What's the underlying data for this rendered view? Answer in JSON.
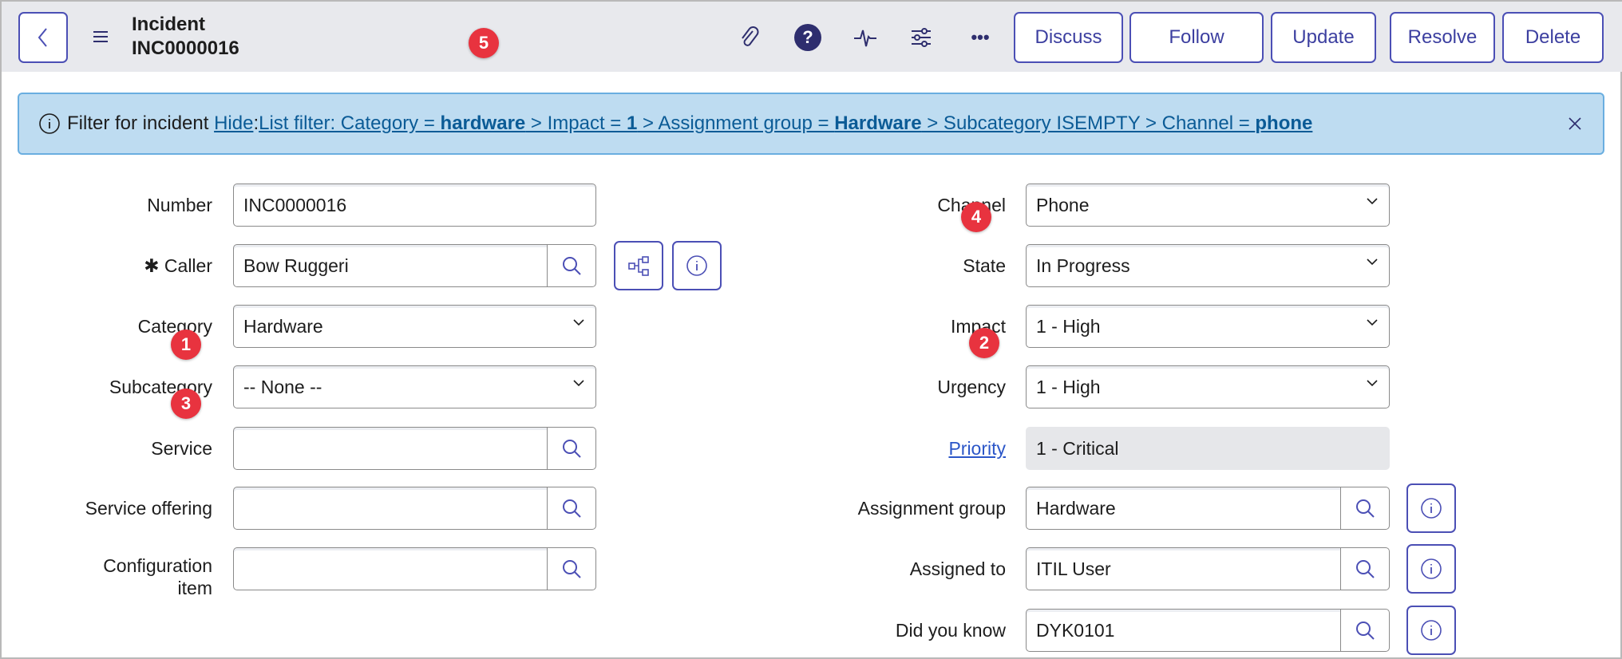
{
  "header": {
    "title": "Incident",
    "number": "INC0000016",
    "buttons": [
      "Discuss",
      "Follow",
      "Update",
      "Resolve",
      "Delete"
    ]
  },
  "banner": {
    "prefix": "Filter for incident",
    "hide": "Hide",
    "sep": ":",
    "f1": "List filter: Category = ",
    "v1": "hardware",
    "f2": " > Impact = ",
    "v2": "1",
    "f3": " > Assignment group = ",
    "v3": "Hardware",
    "f4": " > Subcategory ISEMPTY > Channel = ",
    "v4": "phone"
  },
  "left": [
    {
      "label": "Number",
      "value": "INC0000016"
    },
    {
      "label": "Caller",
      "value": "Bow Ruggeri",
      "required_mark": "✱"
    },
    {
      "label": "Category",
      "value": "Hardware"
    },
    {
      "label": "Subcategory",
      "value": "-- None --"
    },
    {
      "label": "Service",
      "value": ""
    },
    {
      "label": "Service offering",
      "value": ""
    },
    {
      "label": "Configuration item",
      "value": ""
    }
  ],
  "right": [
    {
      "label": "Channel",
      "value": "Phone"
    },
    {
      "label": "State",
      "value": "In Progress"
    },
    {
      "label": "Impact",
      "value": "1 - High"
    },
    {
      "label": "Urgency",
      "value": "1 - High"
    },
    {
      "label": "Priority",
      "value": "1 - Critical"
    },
    {
      "label": "Assignment group",
      "value": "Hardware"
    },
    {
      "label": "Assigned to",
      "value": "ITIL User"
    },
    {
      "label": "Did you know",
      "value": "DYK0101"
    }
  ],
  "badges": [
    "5",
    "4",
    "1",
    "2",
    "3"
  ],
  "colors": {
    "accent": "#4b4fb5",
    "badge": "#e8333f",
    "banner": "#bedcf1"
  }
}
